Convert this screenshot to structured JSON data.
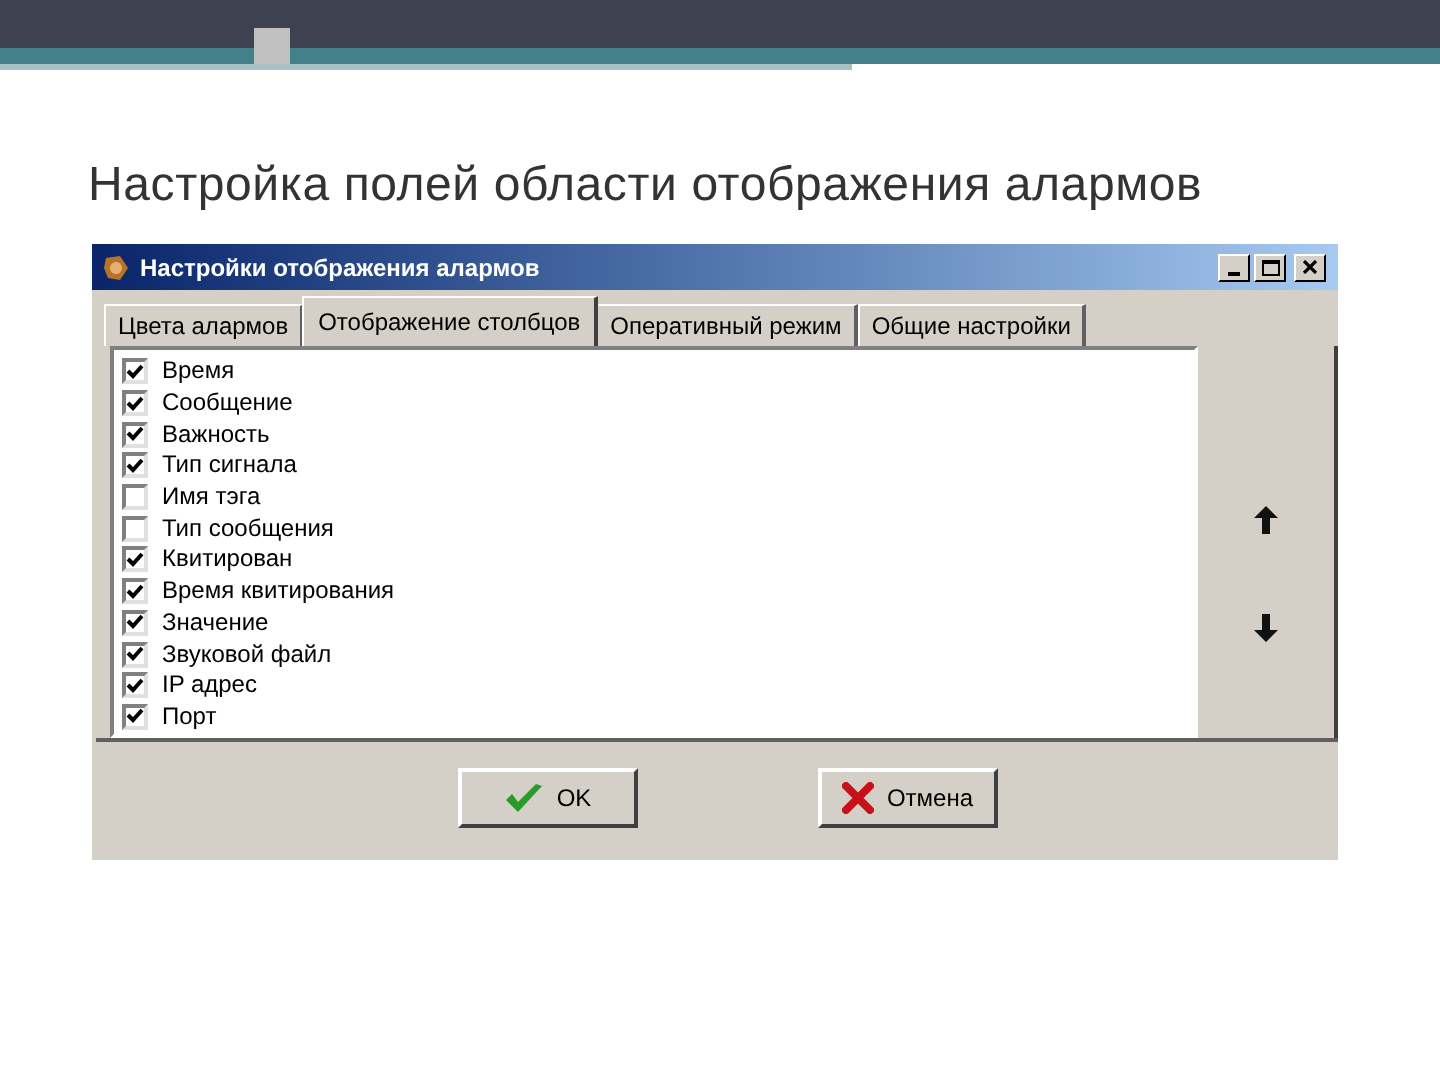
{
  "slide_title": "Настройка полей области отображения алармов",
  "window": {
    "title": "Настройки отображения алармов"
  },
  "tabs": [
    {
      "label": "Цвета алармов",
      "selected": false
    },
    {
      "label": "Отображение столбцов",
      "selected": true
    },
    {
      "label": "Оперативный режим",
      "selected": false
    },
    {
      "label": "Общие настройки",
      "selected": false
    }
  ],
  "columns": [
    {
      "label": "Время",
      "checked": true
    },
    {
      "label": "Сообщение",
      "checked": true
    },
    {
      "label": "Важность",
      "checked": true
    },
    {
      "label": "Тип сигнала",
      "checked": true
    },
    {
      "label": "Имя тэга",
      "checked": false
    },
    {
      "label": "Тип сообщения",
      "checked": false
    },
    {
      "label": "Квитирован",
      "checked": true
    },
    {
      "label": "Время квитирования",
      "checked": true
    },
    {
      "label": "Значение",
      "checked": true
    },
    {
      "label": "Звуковой файл",
      "checked": true
    },
    {
      "label": "IP адрес",
      "checked": true
    },
    {
      "label": "Порт",
      "checked": true
    }
  ],
  "buttons": [
    {
      "label": "OK",
      "kind": "ok"
    },
    {
      "label": "Отмена",
      "kind": "cancel"
    }
  ]
}
